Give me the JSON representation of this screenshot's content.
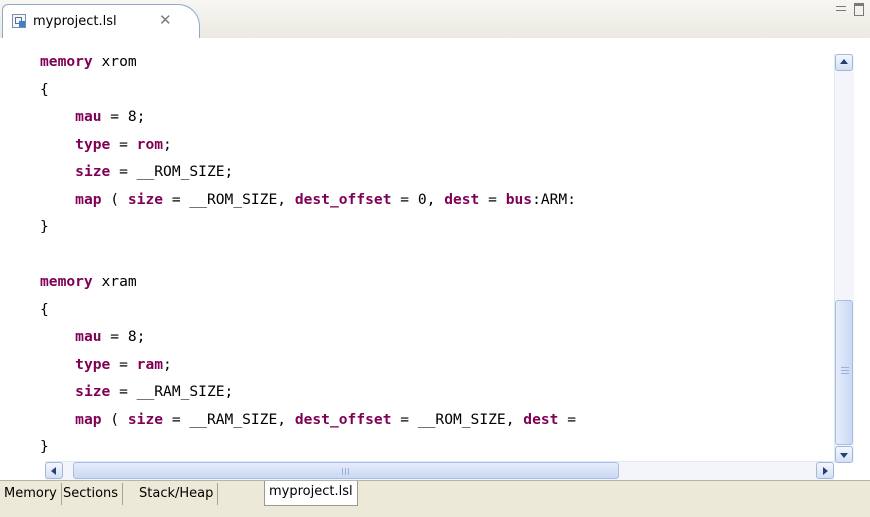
{
  "tab": {
    "title": "myproject.lsl",
    "close_glyph": "✕"
  },
  "code_lines": [
    [
      {
        "t": "memory",
        "k": true
      },
      {
        "t": " xrom",
        "k": false
      }
    ],
    [
      {
        "t": "{",
        "k": false
      }
    ],
    [
      {
        "t": "    ",
        "k": false
      },
      {
        "t": "mau",
        "k": true
      },
      {
        "t": " = 8;",
        "k": false
      }
    ],
    [
      {
        "t": "    ",
        "k": false
      },
      {
        "t": "type",
        "k": true
      },
      {
        "t": " = ",
        "k": false
      },
      {
        "t": "rom",
        "k": true
      },
      {
        "t": ";",
        "k": false
      }
    ],
    [
      {
        "t": "    ",
        "k": false
      },
      {
        "t": "size",
        "k": true
      },
      {
        "t": " = __ROM_SIZE;",
        "k": false
      }
    ],
    [
      {
        "t": "    ",
        "k": false
      },
      {
        "t": "map",
        "k": true
      },
      {
        "t": " ( ",
        "k": false
      },
      {
        "t": "size",
        "k": true
      },
      {
        "t": " = __ROM_SIZE, ",
        "k": false
      },
      {
        "t": "dest_offset",
        "k": true
      },
      {
        "t": " = 0, ",
        "k": false
      },
      {
        "t": "dest",
        "k": true
      },
      {
        "t": " = ",
        "k": false
      },
      {
        "t": "bus",
        "k": true
      },
      {
        "t": ":ARM:",
        "k": false
      }
    ],
    [
      {
        "t": "}",
        "k": false
      }
    ],
    [
      {
        "t": "",
        "k": false
      }
    ],
    [
      {
        "t": "memory",
        "k": true
      },
      {
        "t": " xram",
        "k": false
      }
    ],
    [
      {
        "t": "{",
        "k": false
      }
    ],
    [
      {
        "t": "    ",
        "k": false
      },
      {
        "t": "mau",
        "k": true
      },
      {
        "t": " = 8;",
        "k": false
      }
    ],
    [
      {
        "t": "    ",
        "k": false
      },
      {
        "t": "type",
        "k": true
      },
      {
        "t": " = ",
        "k": false
      },
      {
        "t": "ram",
        "k": true
      },
      {
        "t": ";",
        "k": false
      }
    ],
    [
      {
        "t": "    ",
        "k": false
      },
      {
        "t": "size",
        "k": true
      },
      {
        "t": " = __RAM_SIZE;",
        "k": false
      }
    ],
    [
      {
        "t": "    ",
        "k": false
      },
      {
        "t": "map",
        "k": true
      },
      {
        "t": " ( ",
        "k": false
      },
      {
        "t": "size",
        "k": true
      },
      {
        "t": " = __RAM_SIZE, ",
        "k": false
      },
      {
        "t": "dest_offset",
        "k": true
      },
      {
        "t": " = __ROM_SIZE, ",
        "k": false
      },
      {
        "t": "dest",
        "k": true
      },
      {
        "t": " =",
        "k": false
      }
    ],
    [
      {
        "t": "}",
        "k": false
      }
    ]
  ],
  "bottom_tabs": [
    {
      "label": "Memory",
      "active": false
    },
    {
      "label": "Sections",
      "active": false
    },
    {
      "label": "Stack/Heap",
      "active": false
    },
    {
      "label": "myproject.lsl",
      "active": true
    }
  ],
  "colors": {
    "keyword": "#7f0055",
    "scroll_accent": "#c9d8f4"
  }
}
